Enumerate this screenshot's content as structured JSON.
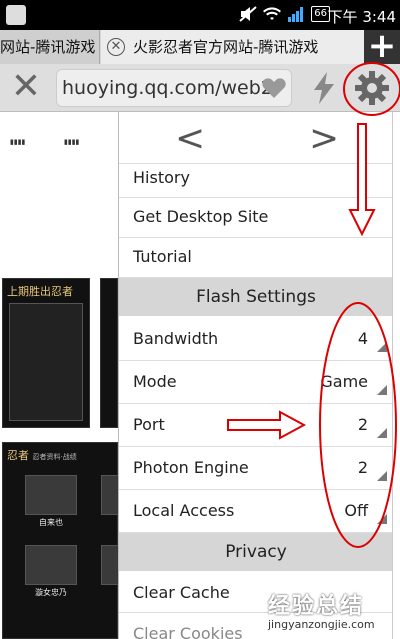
{
  "status_bar": {
    "battery": "66",
    "time": "下午 3:44"
  },
  "tabs": [
    {
      "label": "网站-腾讯游戏"
    },
    {
      "label": "火影忍者官方网站-腾讯游戏"
    }
  ],
  "toolbar": {
    "url": "huoying.qq.com/web2"
  },
  "background_page": {
    "panel1_title": "上期胜出忍者",
    "panel2_title": "忍者",
    "panel2_subtitle": "忍者资料·战绩",
    "captions": [
      "自来也",
      "漩女忠乃"
    ]
  },
  "menu": {
    "items_top": [
      {
        "label": "History"
      },
      {
        "label": "Get Desktop Site"
      },
      {
        "label": "Tutorial"
      }
    ],
    "flash_section": "Flash Settings",
    "flash_items": [
      {
        "label": "Bandwidth",
        "value": "4"
      },
      {
        "label": "Mode",
        "value": "Game"
      },
      {
        "label": "Port",
        "value": "2"
      },
      {
        "label": "Photon Engine",
        "value": "2"
      },
      {
        "label": "Local Access",
        "value": "Off"
      }
    ],
    "privacy_section": "Privacy",
    "privacy_items": [
      {
        "label": "Clear Cache"
      },
      {
        "label": "Clear Cookies"
      }
    ]
  },
  "watermark": {
    "text": "经验总结",
    "url": "jingyanzongjie.com"
  },
  "colors": {
    "annotation": "#d00000",
    "section_bg": "#d6d6d6"
  }
}
